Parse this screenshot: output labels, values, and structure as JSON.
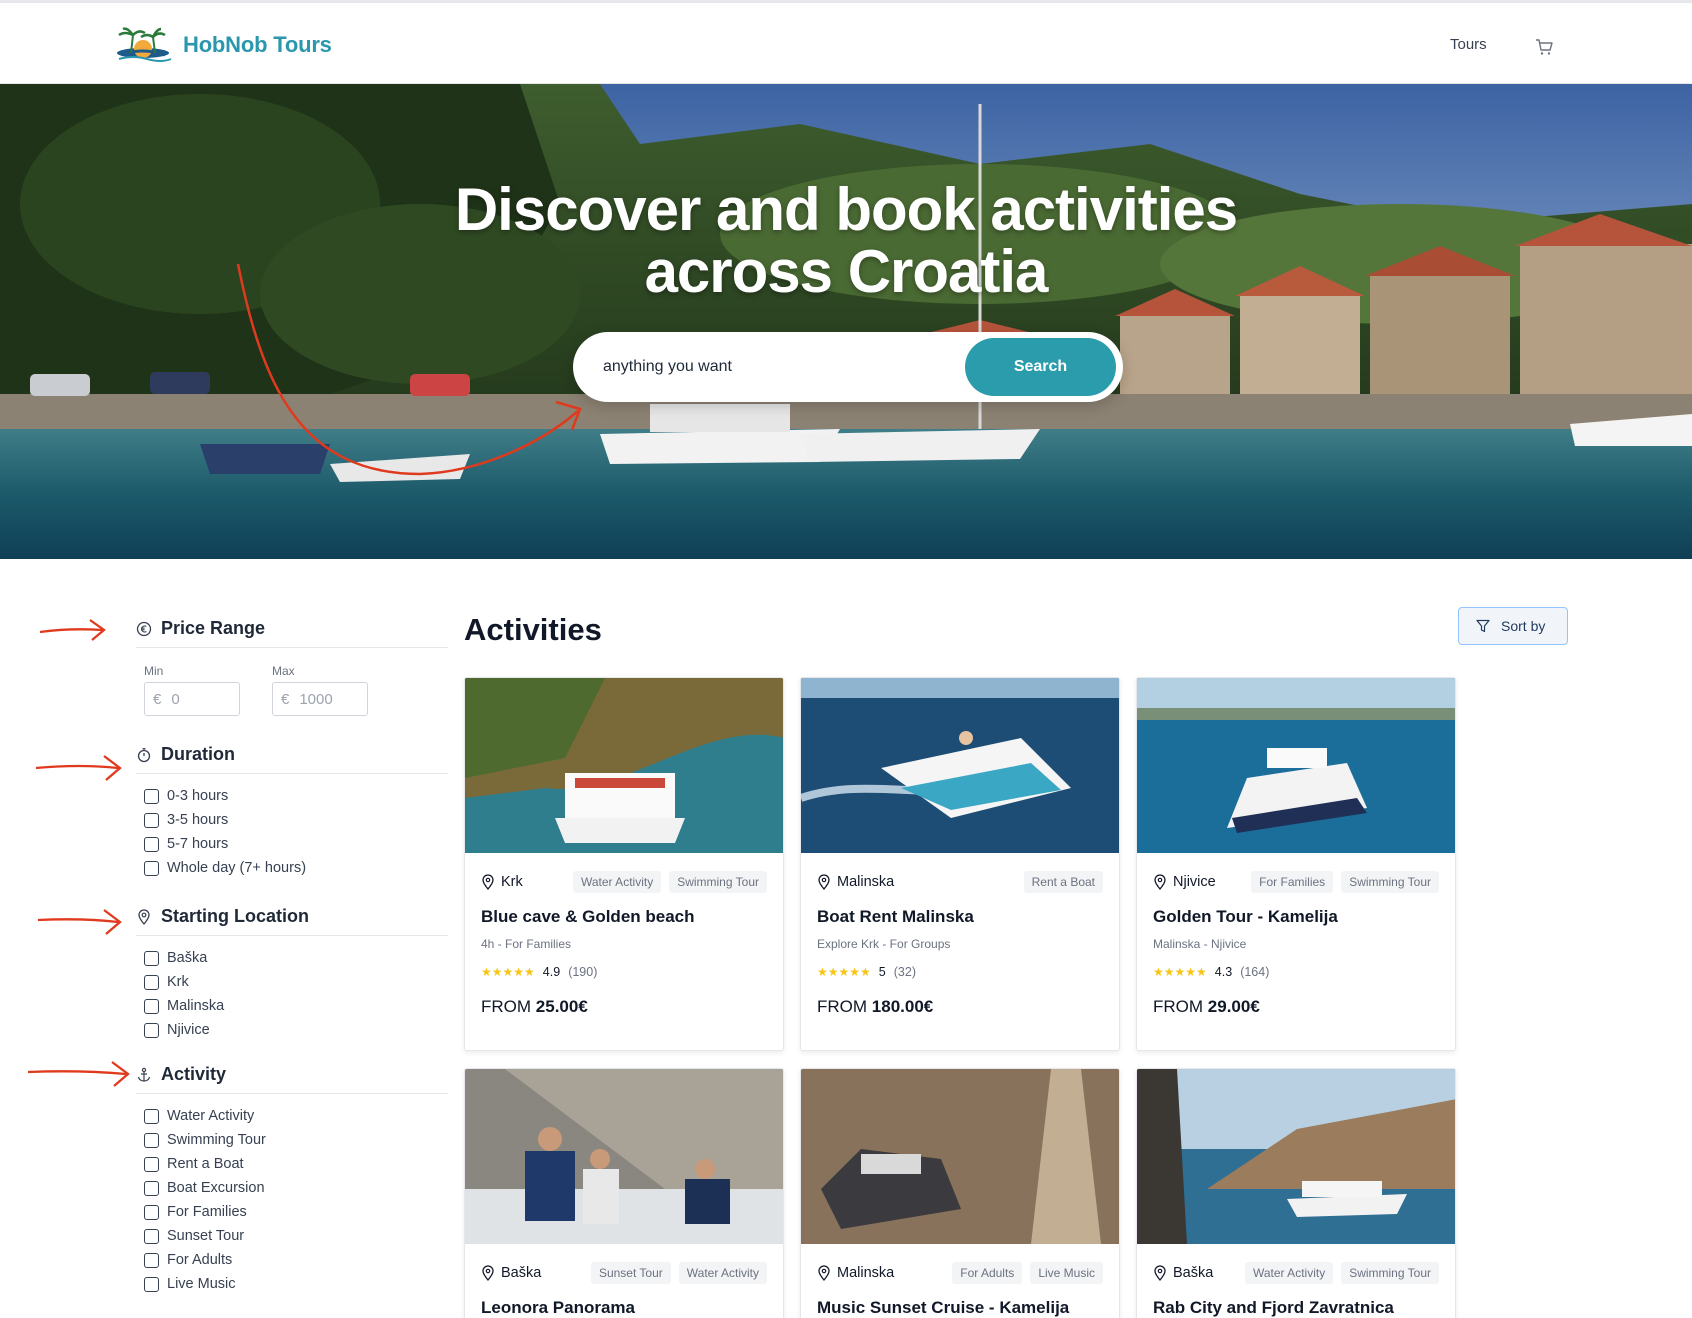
{
  "header": {
    "brand": "HobNob Tours",
    "nav_tours": "Tours",
    "cart_icon": "cart-icon"
  },
  "hero": {
    "title_line1": "Discover and book activities",
    "title_line2": "across Croatia",
    "search_value": "anything you want",
    "search_button": "Search"
  },
  "filters": {
    "price": {
      "title": "Price Range",
      "min_label": "Min",
      "max_label": "Max",
      "currency": "€",
      "min_value": "0",
      "max_value": "1000"
    },
    "duration": {
      "title": "Duration",
      "options": [
        "0-3 hours",
        "3-5 hours",
        "5-7 hours",
        "Whole day (7+ hours)"
      ]
    },
    "location": {
      "title": "Starting Location",
      "options": [
        "Baška",
        "Krk",
        "Malinska",
        "Njivice"
      ]
    },
    "activity": {
      "title": "Activity",
      "options": [
        "Water Activity",
        "Swimming Tour",
        "Rent a Boat",
        "Boat Excursion",
        "For Families",
        "Sunset Tour",
        "For Adults",
        "Live Music"
      ]
    }
  },
  "main": {
    "title": "Activities",
    "sort_label": "Sort by"
  },
  "cards": [
    {
      "location": "Krk",
      "tags": [
        "Water Activity",
        "Swimming Tour"
      ],
      "title": "Blue cave & Golden beach",
      "sub": "4h -  For Families",
      "rating": "4.9",
      "count": "(190)",
      "price_prefix": "FROM ",
      "price": "25.00€"
    },
    {
      "location": "Malinska",
      "tags": [
        "Rent a Boat"
      ],
      "title": "Boat Rent Malinska",
      "sub": "Explore Krk -  For Groups",
      "rating": "5",
      "count": "(32)",
      "price_prefix": "FROM ",
      "price": "180.00€"
    },
    {
      "location": "Njivice",
      "tags": [
        "For Families",
        "Swimming Tour"
      ],
      "title": "Golden Tour - Kamelija",
      "sub": "Malinska -  Njivice",
      "rating": "4.3",
      "count": "(164)",
      "price_prefix": "FROM ",
      "price": "29.00€"
    },
    {
      "location": "Baška",
      "tags": [
        "Sunset Tour",
        "Water Activity"
      ],
      "title": "Leonora Panorama"
    },
    {
      "location": "Malinska",
      "tags": [
        "For Adults",
        "Live Music"
      ],
      "title": "Music Sunset Cruise - Kamelija"
    },
    {
      "location": "Baška",
      "tags": [
        "Water Activity",
        "Swimming Tour"
      ],
      "title": "Rab City and Fjord Zavratnica"
    }
  ],
  "colors": {
    "brand": "#2a97ad",
    "search_button": "#2a9cab",
    "annotation": "#e03a1e",
    "stars": "#f5c518"
  }
}
